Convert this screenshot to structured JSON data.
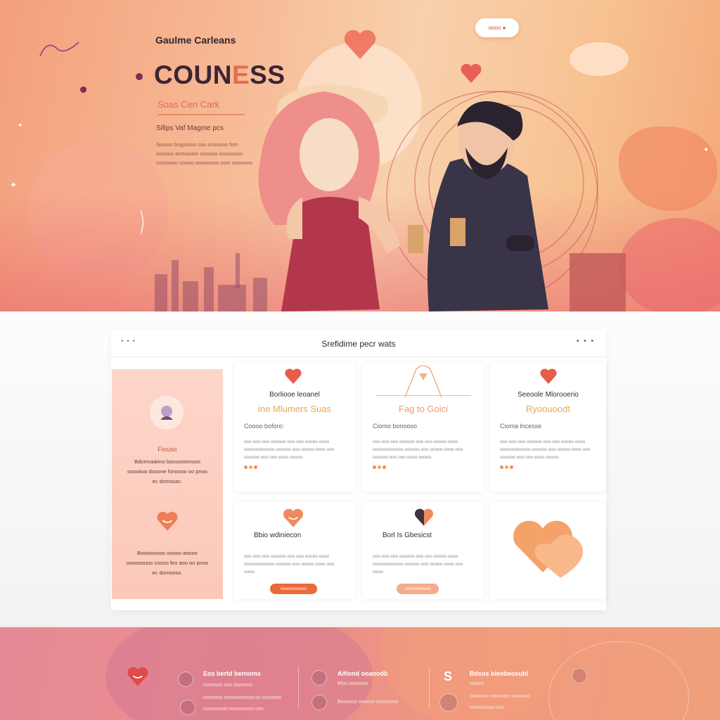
{
  "hero": {
    "brand": "Gaulme Carleans",
    "title_a": "COUN",
    "title_accent": "E",
    "title_b": "SS",
    "subtitle": "Soas Cen Cark",
    "small_text": "Sifips Vaf Magme pcs",
    "paragraph": "Sosoor bogoomo coo ocooooo fom oooooo aomooam oooooo oooooooo comoooo ooooo oooooooo eom oooonoo",
    "pill_label": "oooo ●"
  },
  "section": {
    "title": "Srefidime pecr wats",
    "dots_left": "• • •",
    "dots_right": "• • •"
  },
  "sidebar": {
    "label": "Fiouso",
    "text_1": "Bdomvaaimo boouooomuoo ooooiiuo dooone fonoooo oo pnoo ec domsoac.",
    "text_2": "Boiooooooo ooooo aoooo oooooouoo coooo feo aoo oo pnoo ec domooso."
  },
  "cards": [
    {
      "title": "Borliooe leoanel",
      "accent": "ine Mlumers Suas",
      "label": "Coooo boforo:",
      "text": "ooo ooo ooo oooooo ooo ooo ooooo oooo oooooooooooo oooooo ooo ooooo oooo ooo oooooo ooo ooo oooo ooooo."
    },
    {
      "title": "",
      "accent": "Fag to Goici",
      "label": "Ciomo bonooso",
      "text": "ooo ooo ooo oooooo ooo ooo ooooo oooo oooooooooooo oooooo ooo ooooo oooo ooo oooooo ooo ooo oooo ooooo."
    },
    {
      "title": "Seeoole Mlorooerio",
      "accent": "Ryoouoodt",
      "label": "Cioma lncesse",
      "text": "ooo ooo ooo oooooo ooo ooo ooooo oooo oooooooooooo oooooo ooo ooooo oooo ooo oooooo ooo ooo oooo ooooo."
    },
    {
      "title": "Bbio wdiniecon",
      "label": "",
      "text": "ooo ooo ooo oooooo ooo ooo ooooo oooo oooooooooooo oooooo ooo ooooo oooo ooo oooo.",
      "button": "ooooooooooo"
    },
    {
      "title": "Borl Is Gbesicst",
      "label": "",
      "text": "ooo ooo ooo oooooo ooo ooo ooooo oooo oooooooooooo oooooo ooo ooooo oooo ooo oooo.",
      "button": "ooooooooooo"
    }
  ],
  "footer": {
    "col1_title": "Eos bertd bernoms",
    "col1_sub1": "ooooooo ooo ooooooo",
    "col1_sub2": "ooooooo ooooooooooo oo ooooooo",
    "col1_sub3": "ooooooooo ooooooooo ooo",
    "col2_title": "Aifiond ooanodb",
    "col2_sub1": "Bloo ooooooo",
    "col2_sub2": "Boooooo oooooo oooooooo",
    "col3_title": "Bdsos bieobeosubl",
    "col3_sub1": "ooooo",
    "col3_sub2": "ooooooo ooooooo ooooooo",
    "col3_sub3": "ooooooooo ooo"
  },
  "colors": {
    "accent": "#e86a4e",
    "orange": "#f0a64a",
    "pink_panel": "#fcc8b8",
    "footer": "#eb8d8a"
  }
}
